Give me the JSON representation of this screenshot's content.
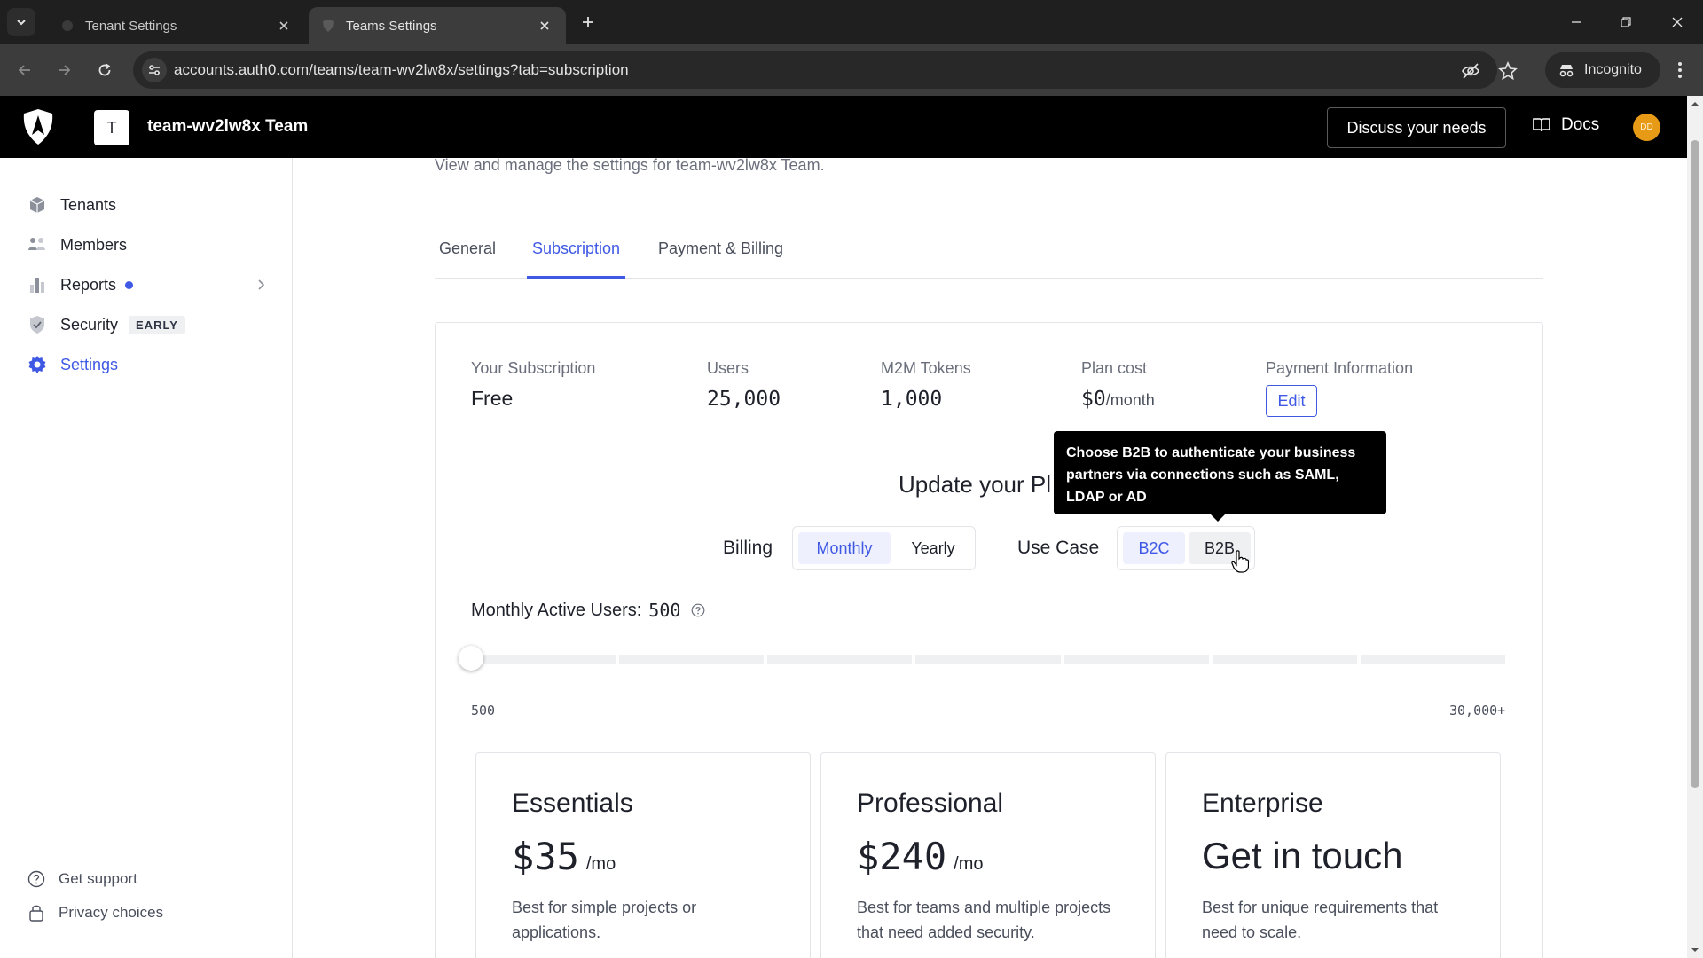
{
  "browser": {
    "tabs": [
      {
        "title": "Tenant Settings",
        "favicon": "globe-icon"
      },
      {
        "title": "Teams Settings",
        "favicon": "auth0-shield-icon"
      }
    ],
    "url": "accounts.auth0.com/teams/team-wv2lw8x/settings?tab=subscription",
    "incognito_label": "Incognito"
  },
  "header": {
    "team_initial": "T",
    "team_name": "team-wv2lw8x Team",
    "discuss_label": "Discuss your needs",
    "docs_label": "Docs",
    "user_initials": "DD",
    "user_avatar_color": "#e69a16"
  },
  "sidebar": {
    "items": [
      {
        "label": "Tenants",
        "icon": "cube-icon"
      },
      {
        "label": "Members",
        "icon": "members-icon"
      },
      {
        "label": "Reports",
        "icon": "bar-chart-icon"
      },
      {
        "label": "Security",
        "icon": "shield-check-icon",
        "badge": "EARLY"
      },
      {
        "label": "Settings",
        "icon": "gear-icon"
      }
    ],
    "footer": [
      {
        "label": "Get support",
        "icon": "help-circle-icon"
      },
      {
        "label": "Privacy choices",
        "icon": "lock-icon"
      }
    ]
  },
  "page": {
    "subtitle": "View and manage the settings for team-wv2lw8x Team.",
    "tabs": [
      {
        "label": "General"
      },
      {
        "label": "Subscription"
      },
      {
        "label": "Payment & Billing"
      }
    ],
    "active_tab": "Subscription",
    "accent_color": "#3f59e4"
  },
  "subscription": {
    "your_subscription": {
      "label": "Your Subscription",
      "value": "Free"
    },
    "users": {
      "label": "Users",
      "value": "25,000"
    },
    "m2m_tokens": {
      "label": "M2M Tokens",
      "value": "1,000"
    },
    "plan_cost": {
      "label": "Plan cost",
      "value": "$0",
      "unit": "/month"
    },
    "payment_information": {
      "label": "Payment Information",
      "button": "Edit"
    }
  },
  "update": {
    "title": "Update your Pl",
    "tooltip": "Choose B2B to authenticate your business partners via connections such as SAML, LDAP or AD",
    "billing_label": "Billing",
    "billing_options": [
      "Monthly",
      "Yearly"
    ],
    "billing_selected": "Monthly",
    "use_case_label": "Use Case",
    "use_case_options": [
      "B2C",
      "B2B"
    ],
    "use_case_selected": "B2C",
    "mau_label": "Monthly Active Users:",
    "mau_value": "500",
    "slider_min": "500",
    "slider_max": "30,000+",
    "slider_position_fraction": 0
  },
  "plans": [
    {
      "name": "Essentials",
      "price": "$35",
      "unit": "/mo",
      "description": "Best for simple projects or applications."
    },
    {
      "name": "Professional",
      "price": "$240",
      "unit": "/mo",
      "description": "Best for teams and multiple projects that need added security."
    },
    {
      "name": "Enterprise",
      "price": "Get in touch",
      "unit": "",
      "description": "Best for unique requirements that need to scale."
    }
  ]
}
